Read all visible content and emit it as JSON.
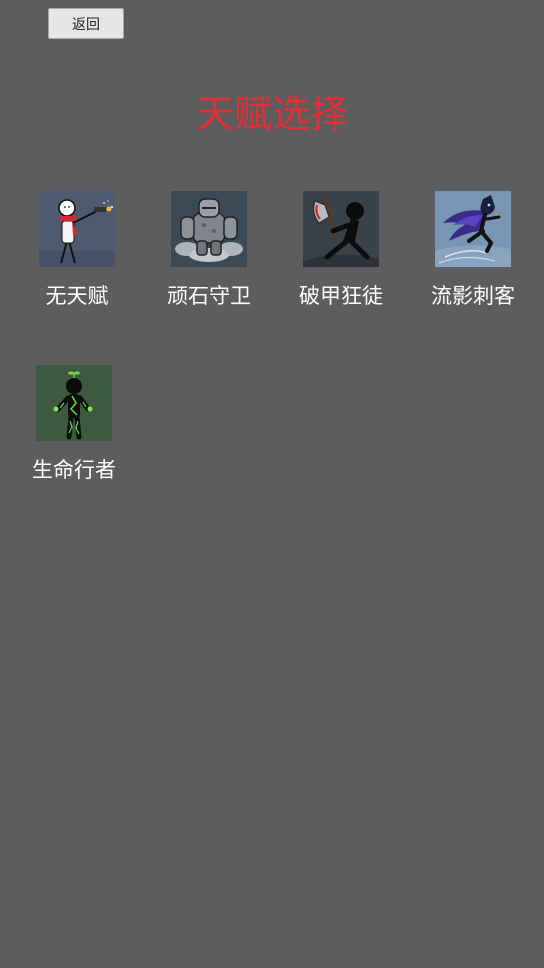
{
  "header": {
    "back_label": "返回",
    "title": "天赋选择",
    "title_color": "#e62e38"
  },
  "talents": [
    {
      "label": "无天赋",
      "icon": "stickman-gunner-icon"
    },
    {
      "label": "顽石守卫",
      "icon": "stone-golem-icon"
    },
    {
      "label": "破甲狂徒",
      "icon": "axe-berserker-icon"
    },
    {
      "label": "流影刺客",
      "icon": "shadow-assassin-icon"
    },
    {
      "label": "生命行者",
      "icon": "life-walker-icon"
    }
  ],
  "colors": {
    "background": "#5d5d5d",
    "label_text": "#ffffff"
  }
}
